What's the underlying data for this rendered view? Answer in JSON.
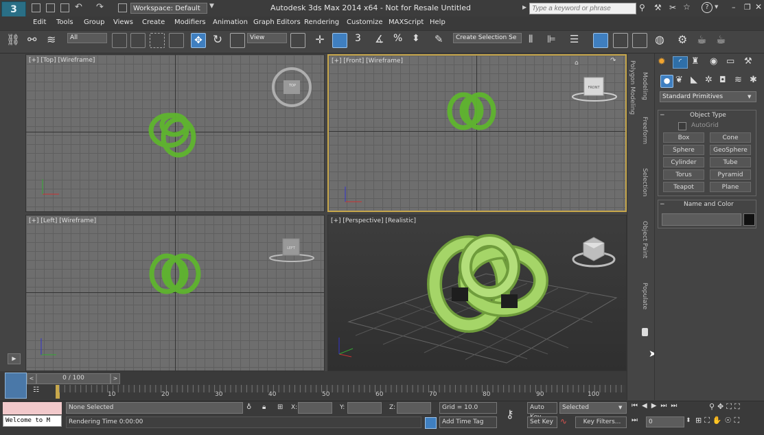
{
  "titlebar": {
    "logo": "3",
    "workspace": "Workspace: Default",
    "title": "Autodesk 3ds Max  2014 x64  - Not for Resale   Untitled",
    "search_placeholder": "Type a keyword or phrase"
  },
  "menu": [
    "Edit",
    "Tools",
    "Group",
    "Views",
    "Create",
    "Modifiers",
    "Animation",
    "Graph Editors",
    "Rendering",
    "Customize",
    "MAXScript",
    "Help"
  ],
  "toolbar": {
    "filter": "All",
    "refcoord": "View",
    "snap_labels": [
      "3",
      "%"
    ],
    "selection_set": "Create Selection Se"
  },
  "viewports": {
    "top": "[+] [Top] [Wireframe]",
    "front": "[+] [Front] [Wireframe]",
    "left": "[+] [Left] [Wireframe]",
    "persp": "[+] [Perspective] [Realistic]",
    "cube_top": "TOP",
    "cube_front": "FRONT",
    "cube_left": "LEFT"
  },
  "side_tabs": [
    "Polygon Modeling",
    "Modeling",
    "Freeform",
    "Selection",
    "Object Paint",
    "Populate"
  ],
  "command_panel": {
    "category": "Standard Primitives",
    "object_type": "Object Type",
    "autogrid": "AutoGrid",
    "buttons": [
      "Box",
      "Cone",
      "Sphere",
      "GeoSphere",
      "Cylinder",
      "Tube",
      "Torus",
      "Pyramid",
      "Teapot",
      "Plane"
    ],
    "name_color": "Name and Color"
  },
  "timeline": {
    "frame": "0 / 100",
    "ticks": [
      "10",
      "20",
      "30",
      "40",
      "50",
      "60",
      "70",
      "80",
      "90",
      "100"
    ]
  },
  "status": {
    "listener": "Welcome to M",
    "selection": "None Selected",
    "rendering": "Rendering Time  0:00:00",
    "x_label": "X:",
    "y_label": "Y:",
    "z_label": "Z:",
    "grid": "Grid = 10.0",
    "add_time_tag": "Add Time Tag",
    "auto_key": "Auto Key",
    "set_key": "Set Key",
    "key_mode": "Selected",
    "key_filters": "Key Filters...",
    "frame_field": "0"
  },
  "colors": {
    "wire_green": "#5fb52e",
    "solid_green": "#9ccf5a",
    "active_border": "#c8a84b"
  }
}
